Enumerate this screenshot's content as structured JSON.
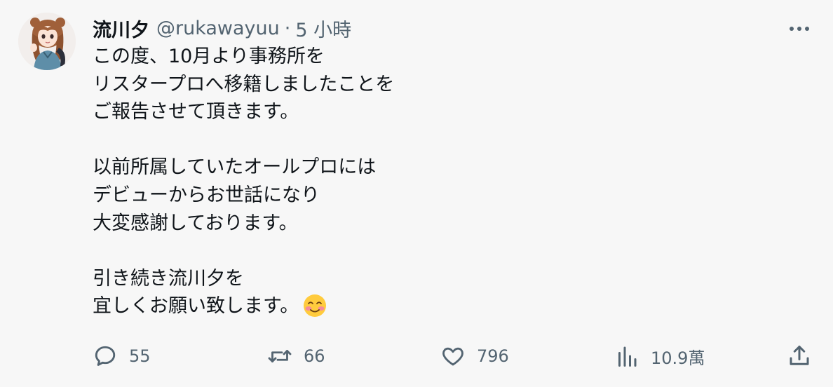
{
  "tweet": {
    "author": {
      "display_name": "流川夕",
      "handle": "@rukawayuu"
    },
    "separator": "·",
    "timestamp": "5 小時",
    "text": "この度、10月より事務所を\nリスタープロへ移籍しましたことを\nご報告させて頂きます。\n\n以前所属していたオールプロには\nデビューからお世話になり\n大変感謝しております。\n\n引き続き流川夕を\n宜しくお願い致します。",
    "emoji": "smiling-face-with-smiling-eyes-emoji"
  },
  "actions": {
    "reply_count": "55",
    "retweet_count": "66",
    "like_count": "796",
    "view_count": "10.9萬"
  },
  "icons": {
    "reply": "reply-icon",
    "retweet": "retweet-icon",
    "like": "heart-icon",
    "views": "views-icon",
    "share": "share-icon",
    "more": "more-icon"
  },
  "colors": {
    "background": "#f7f7f7",
    "text": "#0f1419",
    "secondary": "#536471"
  }
}
